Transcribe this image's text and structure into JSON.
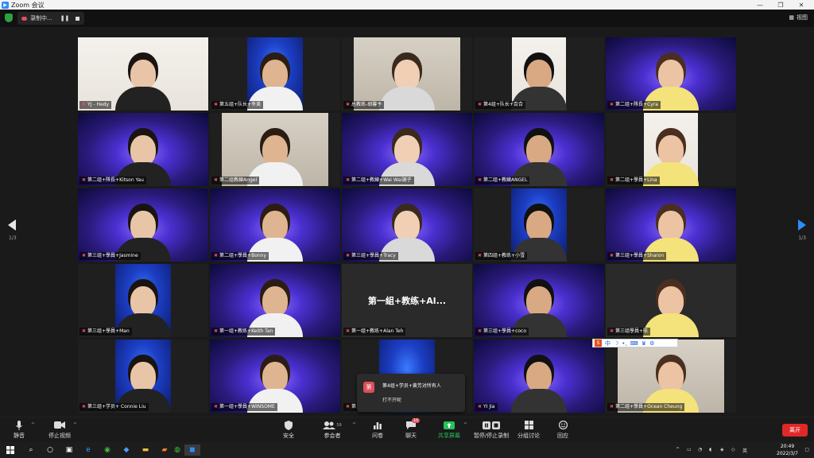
{
  "window": {
    "title": "Zoom 会议"
  },
  "recording": {
    "label": "录制中..."
  },
  "view": {
    "label": "视图"
  },
  "nav": {
    "page": "1/3"
  },
  "tiles": [
    {
      "label": "YJ - Hedy",
      "bg": "white"
    },
    {
      "label": "第五组+队长+冬美",
      "bg": "blue"
    },
    {
      "label": "总教练-胡馨予",
      "bg": "room"
    },
    {
      "label": "第4组+队长+百合",
      "bg": "white"
    },
    {
      "label": "第二组+隊長+Cyra",
      "bg": "stage"
    },
    {
      "label": "第二组+隊長+Kitson Yau",
      "bg": "stage"
    },
    {
      "label": "第二组教練Angel",
      "bg": "room"
    },
    {
      "label": "第二组+教練+Wai Wai謝子",
      "bg": "stage"
    },
    {
      "label": "第二组+教練ANGEL",
      "bg": "stage"
    },
    {
      "label": "第二组+學員+Lina",
      "bg": "white"
    },
    {
      "label": "第三组+學員+Jasmine",
      "bg": "stage"
    },
    {
      "label": "第二组+學員+Bonny",
      "bg": "stage"
    },
    {
      "label": "第三组+學員+Tracy",
      "bg": "stage"
    },
    {
      "label": "第四组+教练+小雪",
      "bg": "blue"
    },
    {
      "label": "第三组+學員+Sharon",
      "bg": "stage"
    },
    {
      "label": "第三组+學員+Man",
      "bg": "blue"
    },
    {
      "label": "第一组+教练+Keith Tan",
      "bg": "stage"
    },
    {
      "label": "第一组+教练+Alan Teh",
      "bg": "dark",
      "name": "第一組+教练+Al..."
    },
    {
      "label": "第三组+學員+coco",
      "bg": "stage"
    },
    {
      "label": "第三组學員+陈",
      "bg": "dark"
    },
    {
      "label": "第三组+学员+ Connie Liu",
      "bg": "blue"
    },
    {
      "label": "第一组+學員+WINSOME",
      "bg": "stage"
    },
    {
      "label": "第",
      "bg": "blue"
    },
    {
      "label": "YI Jia",
      "bg": "stage"
    },
    {
      "label": "第二组+學員+Ocean Cheung",
      "bg": "room"
    }
  ],
  "toast": {
    "avatar": "第",
    "from": "第4组+学员+黄芳对所有人",
    "message": "打不开呢"
  },
  "ime": {
    "label": "中"
  },
  "toolbar": {
    "mute": "静音",
    "video": "停止视频",
    "security": "安全",
    "participants": "参会者",
    "participants_count": "59",
    "polls": "问卷",
    "chat": "聊天",
    "chat_badge": "10",
    "share": "共享屏幕",
    "record": "暂停/停止录制",
    "breakout": "分组讨论",
    "reactions": "回应",
    "leave": "离开"
  },
  "taskbar": {
    "time": "20:49",
    "date": "2022/3/7",
    "ime": "英"
  },
  "colors": {
    "accent_green": "#26c15c",
    "leave_red": "#e02828",
    "active_speaker": "#c9e84a",
    "zoom_blue": "#2d8cff"
  }
}
